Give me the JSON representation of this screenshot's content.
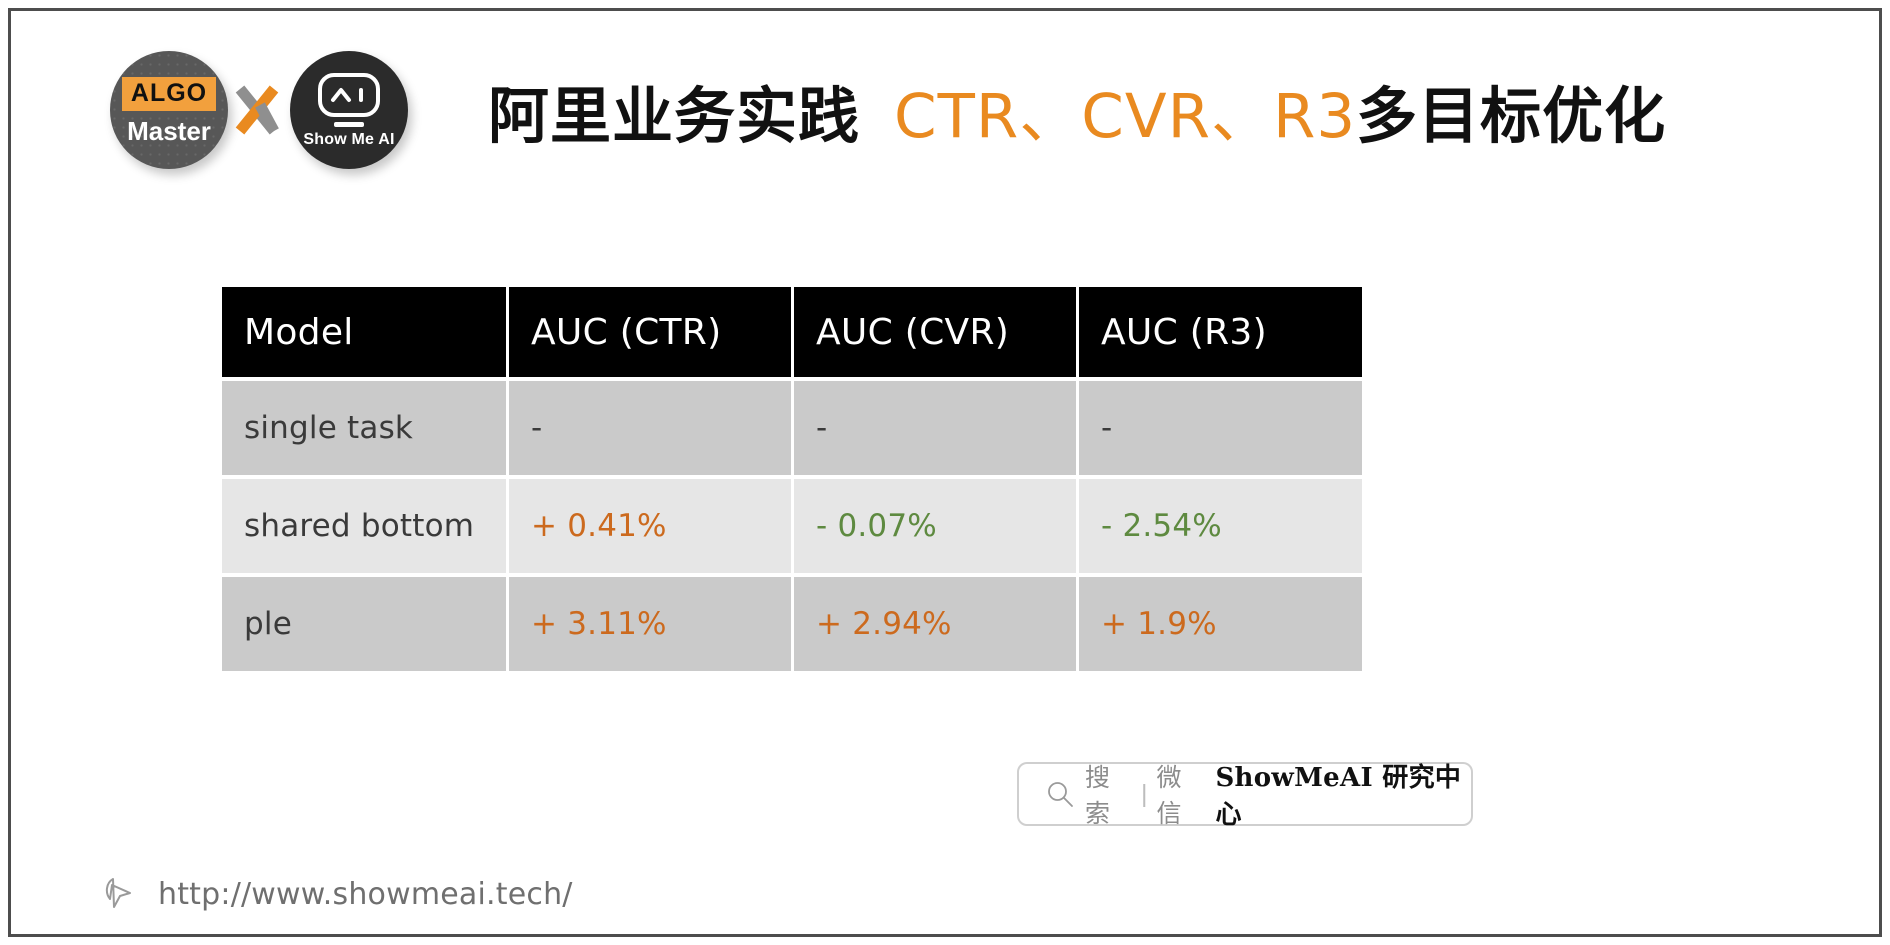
{
  "header": {
    "logo_left": {
      "top_text": "ALGO",
      "bottom_text": "Master"
    },
    "logo_separator": "x",
    "logo_right": {
      "text": "Show Me AI"
    },
    "title_cn": "阿里业务实践",
    "title_orange": "CTR、CVR、R3",
    "title_tail": "多目标优化"
  },
  "table": {
    "columns": [
      "Model",
      "AUC (CTR)",
      "AUC (CVR)",
      "AUC (R3)"
    ],
    "rows": [
      {
        "model": "single task",
        "ctr": "-",
        "cvr": "-",
        "r3": "-"
      },
      {
        "model": "shared bottom",
        "ctr": "+ 0.41%",
        "cvr": "- 0.07%",
        "r3": "- 2.54%"
      },
      {
        "model": "ple",
        "ctr": "+ 3.11%",
        "cvr": "+ 2.94%",
        "r3": "+ 1.9%"
      }
    ]
  },
  "search_badge": {
    "icon": "search-icon",
    "label": "搜索",
    "divider": "|",
    "platform": "微信",
    "brand": "ShowMeAI 研究中心"
  },
  "footer": {
    "icon": "cursor-icon",
    "url": "http://www.showmeai.tech/"
  },
  "colors": {
    "accent_orange": "#E98A20",
    "value_up": "#CC6A1E",
    "value_down": "#5E8A40",
    "header_bg": "#000000",
    "row_dark": "#CACACA",
    "row_light": "#E6E6E6"
  }
}
